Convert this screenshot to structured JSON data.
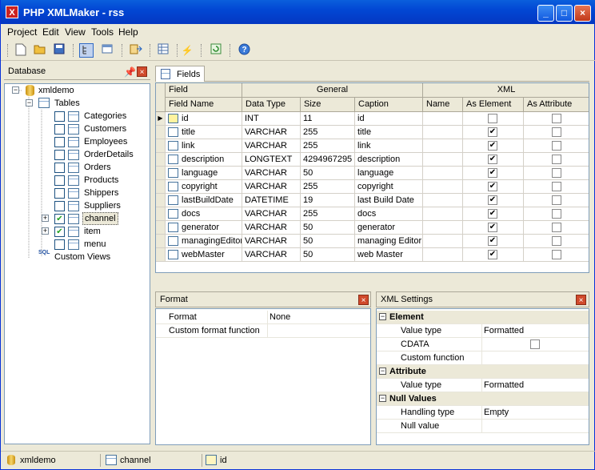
{
  "window": {
    "title": "PHP XMLMaker - rss",
    "app_icon_letter": "X",
    "minimize": "_",
    "maximize": "□",
    "close": "×"
  },
  "menu": [
    "Project",
    "Edit",
    "View",
    "Tools",
    "Help"
  ],
  "database_panel": {
    "title": "Database",
    "root": "xmldemo",
    "tables_label": "Tables",
    "tables": [
      {
        "name": "Categories",
        "checked": false,
        "expandable": false,
        "selected": false
      },
      {
        "name": "Customers",
        "checked": false,
        "expandable": false,
        "selected": false
      },
      {
        "name": "Employees",
        "checked": false,
        "expandable": false,
        "selected": false
      },
      {
        "name": "OrderDetails",
        "checked": false,
        "expandable": false,
        "selected": false
      },
      {
        "name": "Orders",
        "checked": false,
        "expandable": false,
        "selected": false
      },
      {
        "name": "Products",
        "checked": false,
        "expandable": false,
        "selected": false
      },
      {
        "name": "Shippers",
        "checked": false,
        "expandable": false,
        "selected": false
      },
      {
        "name": "Suppliers",
        "checked": false,
        "expandable": false,
        "selected": false
      },
      {
        "name": "channel",
        "checked": true,
        "expandable": true,
        "selected": true
      },
      {
        "name": "item",
        "checked": true,
        "expandable": true,
        "selected": false
      },
      {
        "name": "menu",
        "checked": false,
        "expandable": false,
        "selected": false
      }
    ],
    "custom_views": "Custom Views"
  },
  "fields_tab": "Fields",
  "grid": {
    "group_headers": {
      "field": "Field",
      "general": "General",
      "xml": "XML"
    },
    "columns": [
      "Field Name",
      "Data Type",
      "Size",
      "Caption",
      "Name",
      "As Element",
      "As Attribute"
    ],
    "rows": [
      {
        "name": "id",
        "type": "INT",
        "size": "11",
        "caption": "id",
        "xmlname": "",
        "el": false,
        "attr": false,
        "key": true
      },
      {
        "name": "title",
        "type": "VARCHAR",
        "size": "255",
        "caption": "title",
        "xmlname": "",
        "el": true,
        "attr": false
      },
      {
        "name": "link",
        "type": "VARCHAR",
        "size": "255",
        "caption": "link",
        "xmlname": "",
        "el": true,
        "attr": false
      },
      {
        "name": "description",
        "type": "LONGTEXT",
        "size": "4294967295",
        "caption": "description",
        "xmlname": "",
        "el": true,
        "attr": false
      },
      {
        "name": "language",
        "type": "VARCHAR",
        "size": "50",
        "caption": "language",
        "xmlname": "",
        "el": true,
        "attr": false
      },
      {
        "name": "copyright",
        "type": "VARCHAR",
        "size": "255",
        "caption": "copyright",
        "xmlname": "",
        "el": true,
        "attr": false
      },
      {
        "name": "lastBuildDate",
        "type": "DATETIME",
        "size": "19",
        "caption": "last Build Date",
        "xmlname": "",
        "el": true,
        "attr": false
      },
      {
        "name": "docs",
        "type": "VARCHAR",
        "size": "255",
        "caption": "docs",
        "xmlname": "",
        "el": true,
        "attr": false
      },
      {
        "name": "generator",
        "type": "VARCHAR",
        "size": "50",
        "caption": "generator",
        "xmlname": "",
        "el": true,
        "attr": false
      },
      {
        "name": "managingEditor",
        "type": "VARCHAR",
        "size": "50",
        "caption": "managing Editor",
        "xmlname": "",
        "el": true,
        "attr": false
      },
      {
        "name": "webMaster",
        "type": "VARCHAR",
        "size": "50",
        "caption": "web Master",
        "xmlname": "",
        "el": true,
        "attr": false
      }
    ],
    "scroll_grip": "|||"
  },
  "format_panel": {
    "title": "Format",
    "rows": [
      {
        "label": "Format",
        "value": "None"
      },
      {
        "label": "Custom format function",
        "value": ""
      }
    ]
  },
  "xml_settings": {
    "title": "XML Settings",
    "sections": [
      {
        "name": "Element",
        "rows": [
          {
            "label": "Value type",
            "value": "Formatted",
            "checkbox": false
          },
          {
            "label": "CDATA",
            "value": "",
            "checkbox": true
          },
          {
            "label": "Custom function",
            "value": "",
            "checkbox": false
          }
        ]
      },
      {
        "name": "Attribute",
        "rows": [
          {
            "label": "Value type",
            "value": "Formatted",
            "checkbox": false
          }
        ]
      },
      {
        "name": "Null Values",
        "rows": [
          {
            "label": "Handling type",
            "value": "Empty",
            "checkbox": false
          },
          {
            "label": "Null value",
            "value": "",
            "checkbox": false
          }
        ]
      }
    ]
  },
  "statusbar": [
    "xmldemo",
    "channel",
    "id"
  ],
  "colors": {
    "titlebar": "#0247d4",
    "close": "#d04a2c",
    "selection": "#ece9d8"
  }
}
